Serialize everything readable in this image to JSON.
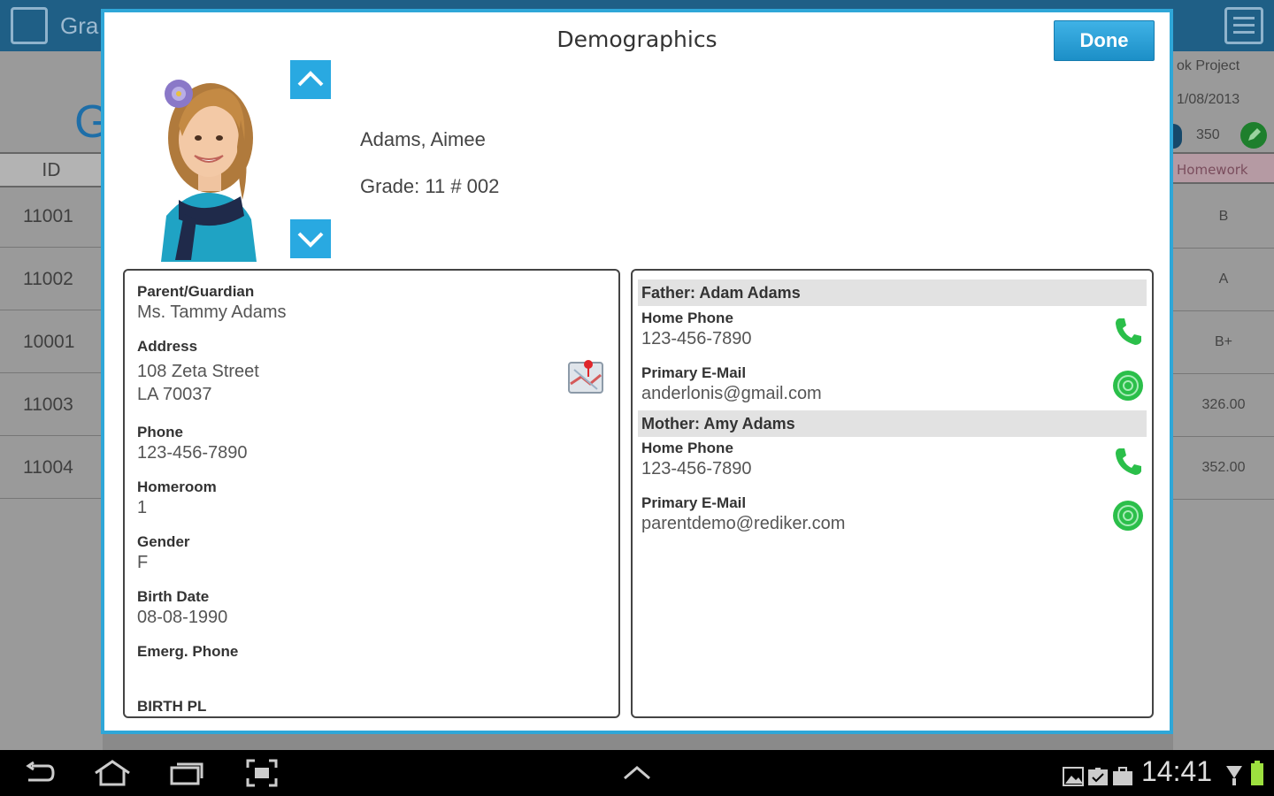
{
  "background": {
    "header_title": "Gra",
    "big_letter": "G",
    "id_column_header": "ID",
    "id_rows": [
      "11001",
      "11002",
      "10001",
      "11003",
      "11004"
    ],
    "right_column": {
      "project": "ok Project",
      "date": "1/08/2013",
      "points": "350",
      "header": "Homework",
      "values": [
        "B",
        "A",
        "B+",
        "326.00",
        "352.00"
      ]
    }
  },
  "dialog": {
    "title": "Demographics",
    "done_label": "Done",
    "student": {
      "name": "Adams, Aimee",
      "grade": "Grade: 11 # 002"
    },
    "left_panel": {
      "parent_label": "Parent/Guardian",
      "parent_value": "Ms. Tammy Adams",
      "address_label": "Address",
      "address_line1": "108 Zeta Street",
      "address_line2": "LA 70037",
      "phone_label": "Phone",
      "phone_value": "123-456-7890",
      "homeroom_label": "Homeroom",
      "homeroom_value": "1",
      "gender_label": "Gender",
      "gender_value": "F",
      "birthdate_label": "Birth Date",
      "birthdate_value": "08-08-1990",
      "emerg_label": "Emerg. Phone",
      "cut_label": "BIRTH PL"
    },
    "right_panel": {
      "father": {
        "heading": "Father: Adam Adams",
        "home_phone_label": "Home Phone",
        "home_phone_value": "123-456-7890",
        "email_label": "Primary E-Mail",
        "email_value": "anderlonis@gmail.com"
      },
      "mother": {
        "heading": "Mother: Amy Adams",
        "home_phone_label": "Home Phone",
        "home_phone_value": "123-456-7890",
        "email_label": "Primary E-Mail",
        "email_value": "parentdemo@rediker.com"
      }
    }
  },
  "system_bar": {
    "clock": "14:41",
    "icons": [
      "back-icon",
      "home-icon",
      "recent-apps-icon",
      "screenshot-icon",
      "up-chevron-icon",
      "gallery-icon",
      "sd-card-icon",
      "briefcase-icon",
      "wifi-icon",
      "battery-icon"
    ]
  },
  "colors": {
    "accent": "#29a9e1",
    "done_button": "#1c8fc7",
    "header_bar": "#1f5f86",
    "contact_green": "#2bbf4a"
  }
}
